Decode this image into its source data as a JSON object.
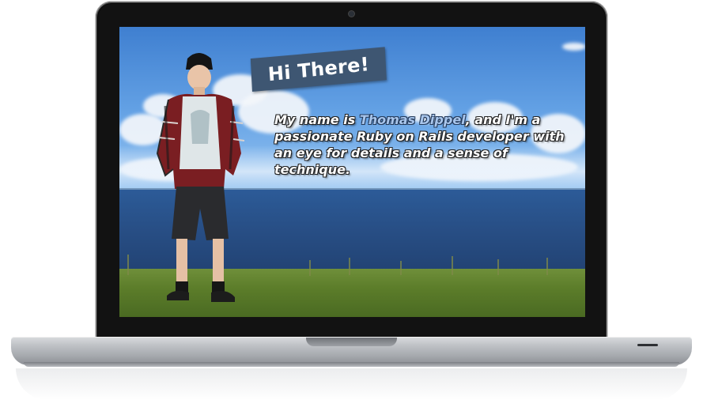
{
  "hero": {
    "greeting": "Hi There!",
    "intro_prefix": "My name is ",
    "name_link": "Thomas Dippel",
    "intro_middle": ", and I'm a passionate ",
    "ruby_link": "Ruby on Rails",
    "intro_suffix": " developer with an eye for details and a sense of technique."
  },
  "colors": {
    "banner": "#3e5672",
    "highlight": "#a9c6ec",
    "sky": "#62a0e4",
    "sea": "#284f86",
    "grass": "#5c7d2a"
  },
  "icons": {
    "camera": "webcam-icon",
    "indicator": "status-led-icon"
  }
}
